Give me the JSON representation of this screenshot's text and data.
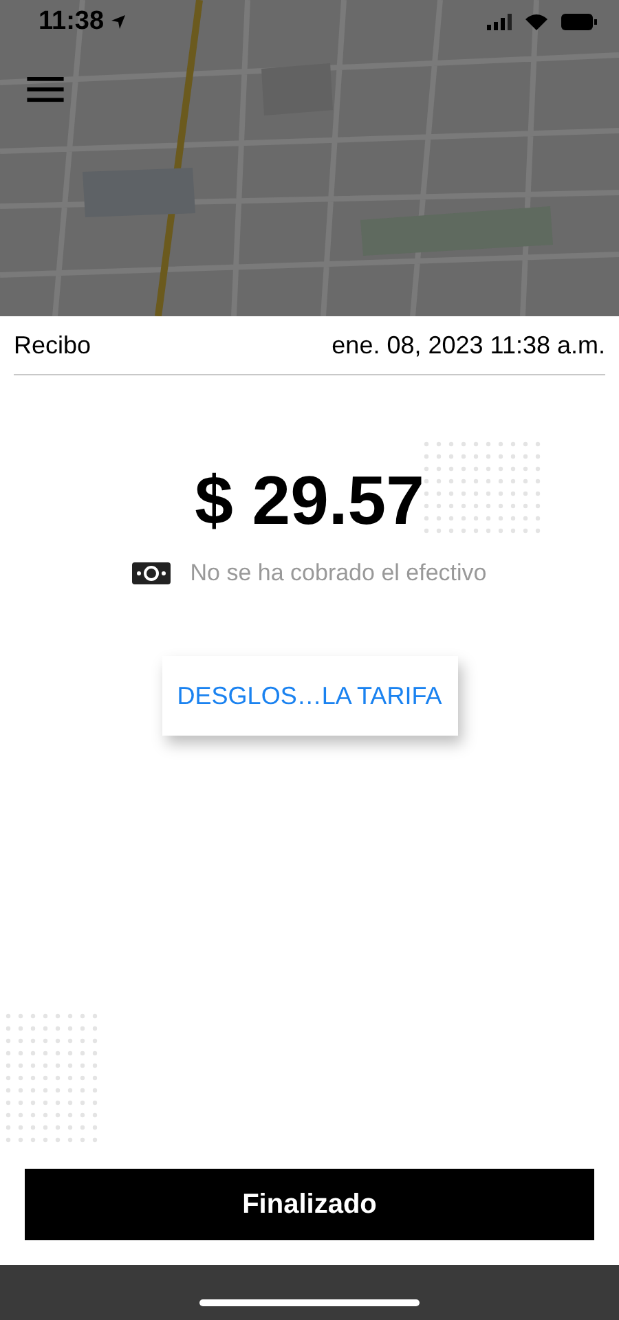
{
  "status_bar": {
    "time": "11:38"
  },
  "receipt": {
    "title": "Recibo",
    "date": "ene. 08, 2023 11:38 a.m.",
    "amount": "$ 29.57",
    "cash_note": "No se ha cobrado el efectivo"
  },
  "fare_button": {
    "label": "DESGLOS…LA TARIFA"
  },
  "done_button": {
    "label": "Finalizado"
  }
}
